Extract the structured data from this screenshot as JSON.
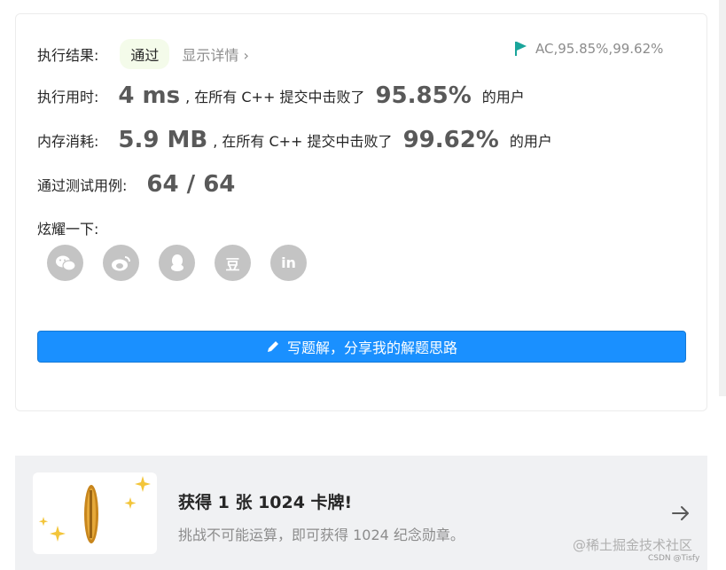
{
  "result": {
    "label": "执行结果:",
    "status": "通过",
    "details": "显示详情",
    "chevron": "›",
    "ac_summary": "AC,95.85%,99.62%"
  },
  "runtime": {
    "label": "执行用时:",
    "value": "4 ms",
    "prefix": ", 在所有 C++ 提交中击败了",
    "percent": "95.85%",
    "suffix": "的用户"
  },
  "memory": {
    "label": "内存消耗:",
    "value": "5.9 MB",
    "prefix": ", 在所有 C++ 提交中击败了",
    "percent": "99.62%",
    "suffix": "的用户"
  },
  "tests": {
    "label": "通过测试用例:",
    "value": "64 / 64"
  },
  "share": {
    "label": "炫耀一下:",
    "icons": [
      "wechat-icon",
      "weibo-icon",
      "qq-icon",
      "douban-icon",
      "linkedin-icon"
    ],
    "douban_glyph": "豆",
    "linkedin_glyph": "in"
  },
  "write_button": {
    "label": "写题解，分享我的解题思路",
    "icon": "pencil-icon"
  },
  "promo": {
    "title": "获得 1 张 1024 卡牌!",
    "subtitle": "挑战不可能运算，即可获得 1024 纪念勋章。",
    "arrow": "arrow-right-icon"
  },
  "watermark": {
    "main": "@稀土掘金技术社区",
    "sub": "CSDN @Tisfy"
  },
  "colors": {
    "primary": "#1a90ff",
    "flag": "#1aa59b",
    "badge_bg": "#f4fbea",
    "icon_gray": "#c4c4c4"
  }
}
